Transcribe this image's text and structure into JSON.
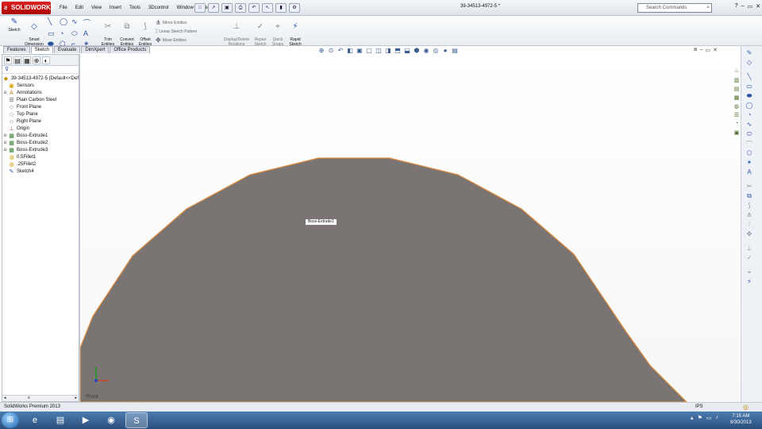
{
  "app": {
    "brand": "SOLIDWORKS",
    "document_title": "39-34513-4972-5 *",
    "menu": [
      "File",
      "Edit",
      "View",
      "Insert",
      "Tools",
      "3Dcontrol",
      "Window",
      "Help"
    ],
    "search_placeholder": "Search Commands"
  },
  "command_manager": {
    "sketch": "Sketch",
    "smart_dimension": "Smart\nDimension",
    "trim": "Trim\nEntities",
    "convert": "Convert\nEntities",
    "offset": "Offset\nEntities",
    "mirror": "Mirror Entities",
    "linear_pattern": "Linear Sketch Pattern",
    "move": "Move Entities",
    "display_delete": "Display/Delete\nRelations",
    "repair": "Repair\nSketch",
    "quick_snaps": "Quick\nSnaps",
    "rapid_sketch": "Rapid\nSketch"
  },
  "tabs": [
    "Features",
    "Sketch",
    "Evaluate",
    "DimXpert",
    "Office Products"
  ],
  "active_tab": "Sketch",
  "tree": {
    "root": "39-34513-4972-5  (Default<<Def",
    "items": [
      {
        "label": "Sensors",
        "icon": "folder-icon",
        "expandable": false
      },
      {
        "label": "Annotations",
        "icon": "annotation-icon",
        "expandable": true
      },
      {
        "label": "Plain Carbon Steel",
        "icon": "material-icon",
        "expandable": false
      },
      {
        "label": "Front Plane",
        "icon": "plane-icon",
        "expandable": false
      },
      {
        "label": "Top Plane",
        "icon": "plane-icon",
        "expandable": false
      },
      {
        "label": "Right Plane",
        "icon": "plane-icon",
        "expandable": false
      },
      {
        "label": "Origin",
        "icon": "origin-icon",
        "expandable": false
      },
      {
        "label": "Boss-Extrude1",
        "icon": "extrude-icon",
        "expandable": true
      },
      {
        "label": "Boss-Extrude2",
        "icon": "extrude-icon",
        "expandable": true
      },
      {
        "label": "Boss-Extrude3",
        "icon": "extrude-icon",
        "expandable": true
      },
      {
        "label": "0.5Fillet1",
        "icon": "fillet-icon",
        "expandable": false
      },
      {
        "label": ".25Fillet2",
        "icon": "fillet-icon",
        "expandable": false
      },
      {
        "label": "Sketch4",
        "icon": "sketch-icon",
        "expandable": false
      }
    ]
  },
  "viewport": {
    "tooltip": "Boss-Extrude1",
    "view_name": "*Front",
    "part_fill": "#7a7572",
    "edge_color": "#e08a3c"
  },
  "status": {
    "product": "SolidWorks Premium 2013",
    "units": "IPS"
  },
  "taskbar": {
    "time": "7:15 AM",
    "date": "8/30/2013"
  }
}
